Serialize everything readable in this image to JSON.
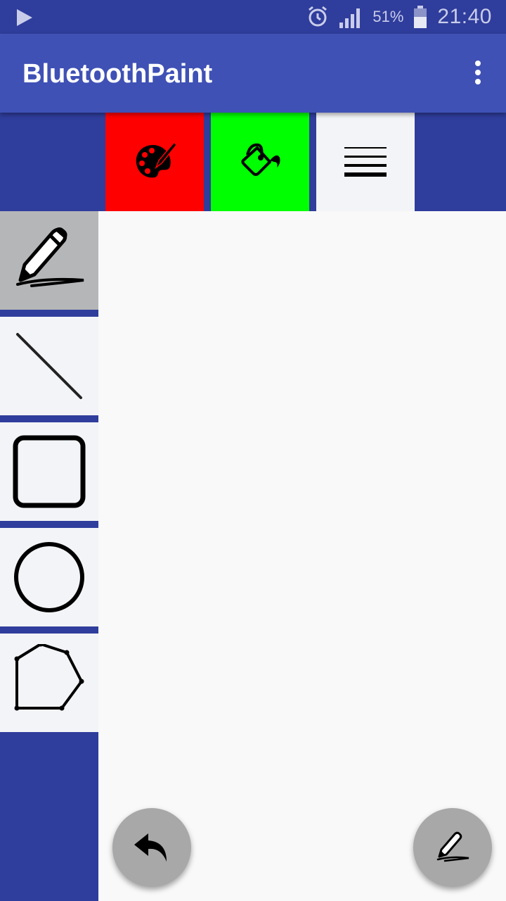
{
  "status_bar": {
    "battery_percent": "51%",
    "time": "21:40",
    "icons": [
      "play-store-icon",
      "alarm-icon",
      "signal-icon",
      "battery-icon"
    ]
  },
  "app_bar": {
    "title": "BluetoothPaint",
    "menu_icon": "overflow-menu-icon"
  },
  "top_toolbar": {
    "buttons": [
      {
        "name": "color-palette-button",
        "icon": "palette-icon",
        "bg": "#ff0000"
      },
      {
        "name": "fill-color-button",
        "icon": "paint-bucket-icon",
        "bg": "#00ff00"
      },
      {
        "name": "stroke-width-button",
        "icon": "line-weight-icon",
        "bg": "#f3f4f7"
      }
    ]
  },
  "tools": [
    {
      "name": "freehand",
      "icon": "pencil-signature-icon",
      "selected": true
    },
    {
      "name": "line",
      "icon": "line-icon",
      "selected": false
    },
    {
      "name": "rectangle",
      "icon": "rectangle-icon",
      "selected": false
    },
    {
      "name": "circle",
      "icon": "circle-icon",
      "selected": false
    },
    {
      "name": "polygon",
      "icon": "polygon-icon",
      "selected": false
    }
  ],
  "fabs": {
    "undo_icon": "undo-icon",
    "pen_icon": "pen-icon"
  },
  "colors": {
    "primary": "#3f51b5",
    "primary_dark": "#2f3d9c",
    "selected_tool": "#b5b6b8"
  }
}
